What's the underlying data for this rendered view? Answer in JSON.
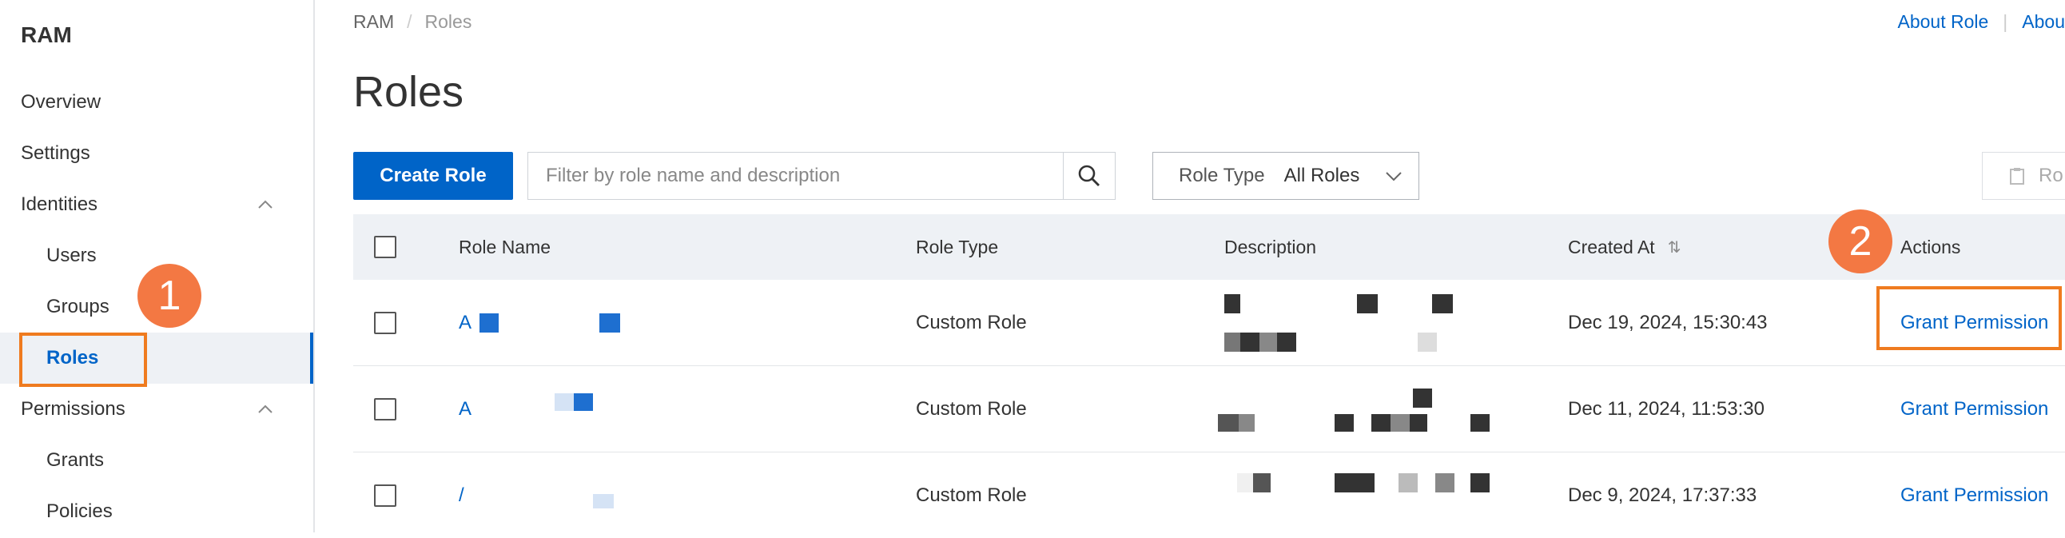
{
  "sidebar": {
    "title": "RAM",
    "items": [
      {
        "label": "Overview"
      },
      {
        "label": "Settings"
      },
      {
        "label": "Identities"
      },
      {
        "label": "Users"
      },
      {
        "label": "Groups"
      },
      {
        "label": "Roles"
      },
      {
        "label": "Permissions"
      },
      {
        "label": "Grants"
      },
      {
        "label": "Policies"
      }
    ]
  },
  "breadcrumb": {
    "root": "RAM",
    "sep": "/",
    "current": "Roles"
  },
  "top_links": {
    "about_role": "About Role",
    "about_more": "Abou"
  },
  "page_title": "Roles",
  "toolbar": {
    "create_label": "Create Role",
    "search_placeholder": "Filter by role name and description",
    "role_type_label": "Role Type",
    "role_type_value": "All Roles",
    "right_button_label": "Ro"
  },
  "table": {
    "headers": {
      "role_name": "Role Name",
      "role_type": "Role Type",
      "description": "Description",
      "created_at": "Created At",
      "actions": "Actions"
    },
    "rows": [
      {
        "name": "A",
        "type": "Custom Role",
        "created": "Dec 19, 2024, 15:30:43",
        "action": "Grant Permission"
      },
      {
        "name": "A",
        "type": "Custom Role",
        "created": "Dec 11, 2024, 11:53:30",
        "action": "Grant Permission"
      },
      {
        "name": "/",
        "type": "Custom Role",
        "created": "Dec 9, 2024, 17:37:33",
        "action": "Grant Permission"
      }
    ]
  },
  "annotations": {
    "step1": "1",
    "step2": "2",
    "color": "#f37843"
  },
  "colors": {
    "primary": "#0064c8",
    "highlight": "#ef7b1f"
  }
}
